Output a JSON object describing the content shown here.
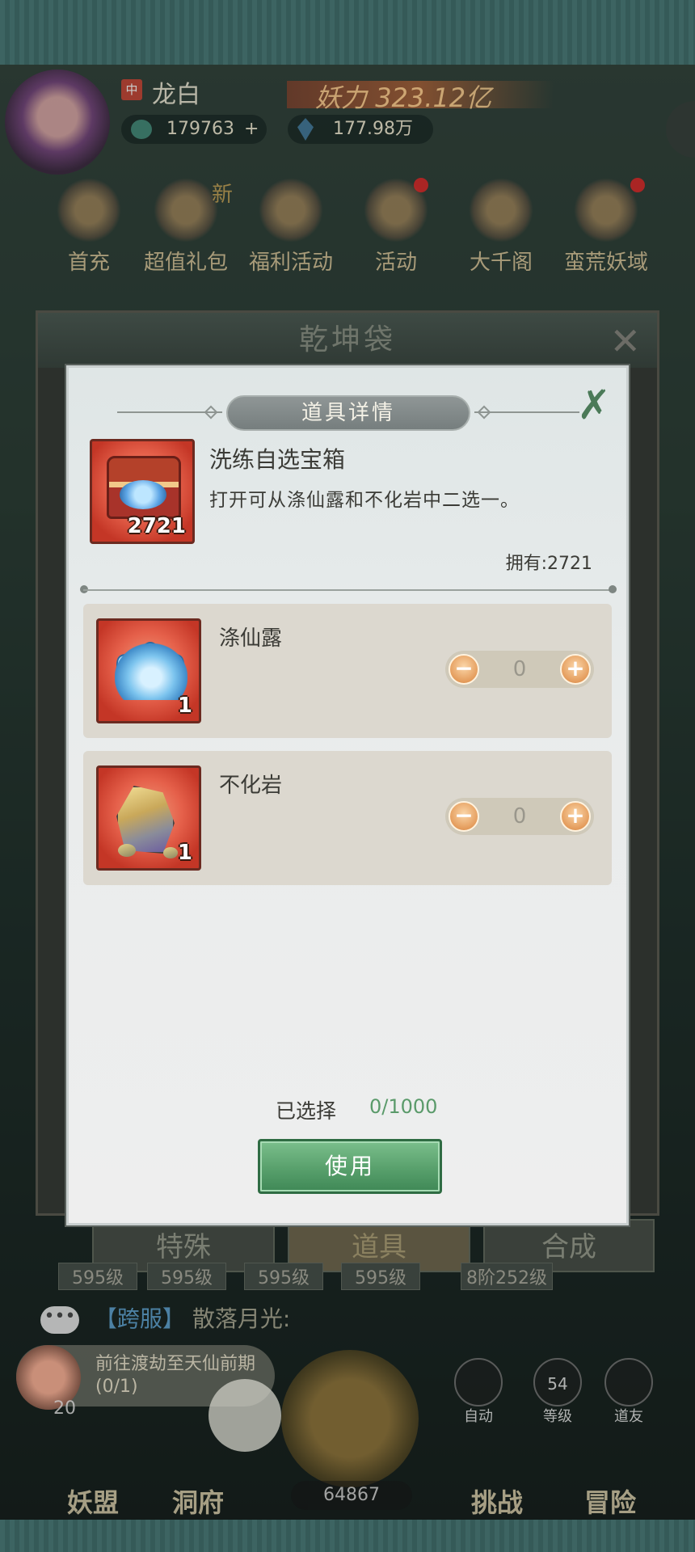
{
  "player": {
    "name": "龙白",
    "server_badge": "中",
    "power": "323.12亿",
    "power_label": "妖力",
    "coins": "179763",
    "gems": "177.98万"
  },
  "menu": {
    "items": [
      {
        "label": "首充"
      },
      {
        "label": "超值礼包"
      },
      {
        "label": "福利活动"
      },
      {
        "label": "活动"
      },
      {
        "label": "大千阁"
      },
      {
        "label": "蛮荒妖域"
      }
    ],
    "new_badge": "新"
  },
  "bag": {
    "title": "乾坤袋",
    "tabs": [
      {
        "label": "特殊"
      },
      {
        "label": "道具"
      },
      {
        "label": "合成"
      }
    ],
    "levels": [
      "595级",
      "595级",
      "595级",
      "595级",
      "8阶252级"
    ]
  },
  "dialog": {
    "title": "道具详情",
    "item": {
      "name": "洗练自选宝箱",
      "description": "打开可从涤仙露和不化岩中二选一。",
      "count": "2721",
      "owned_text": "拥有:2721"
    },
    "choices": [
      {
        "name": "涤仙露",
        "icon": "lotus-icon",
        "count": "1",
        "quantity": "0"
      },
      {
        "name": "不化岩",
        "icon": "rock-icon",
        "count": "1",
        "quantity": "0"
      }
    ],
    "selected_label": "已选择",
    "selected_value": "0/1000",
    "use_label": "使用"
  },
  "chat": {
    "channel": "【跨服】",
    "message": "散落月光:"
  },
  "quest": {
    "text": "前往渡劫至天仙前期(0/1)",
    "count": "20"
  },
  "hud": {
    "auto_label": "自动",
    "level_value": "54",
    "level_label": "等级",
    "friend_label": "道友",
    "stamina": "64867"
  },
  "bottom_nav": [
    {
      "label": "妖盟"
    },
    {
      "label": "洞府"
    },
    {
      "label": "挑战"
    },
    {
      "label": "冒险"
    }
  ],
  "colors": {
    "use_button": "#58a06c",
    "selected_value": "#5a9a6a",
    "item_frame": "#e5604a"
  }
}
